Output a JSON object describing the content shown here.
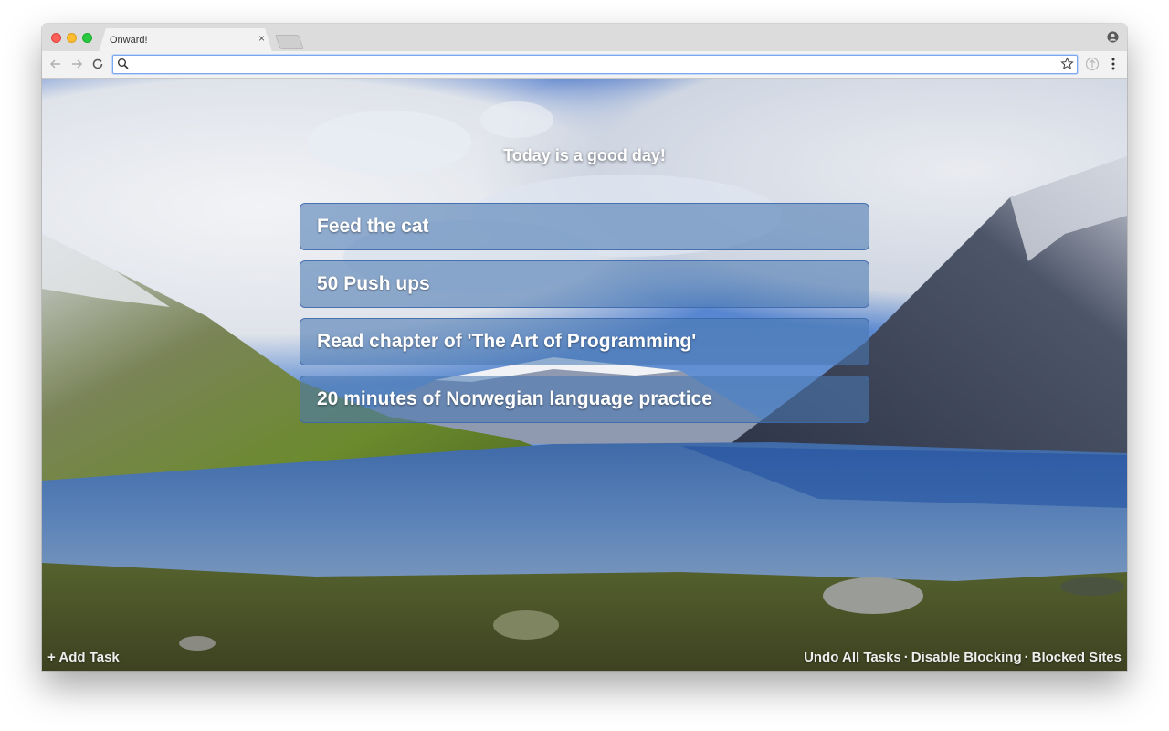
{
  "browser": {
    "tab_title": "Onward!",
    "tab_close": "×",
    "url": ""
  },
  "page": {
    "greeting": "Today is a good day!",
    "tasks": [
      "Feed the cat",
      "50 Push ups",
      "Read chapter of 'The Art of Programming'",
      "20 minutes of Norwegian language practice"
    ]
  },
  "footer": {
    "add_task": "+ Add Task",
    "undo_all": "Undo All Tasks",
    "disable_blocking": "Disable Blocking",
    "blocked_sites": "Blocked Sites",
    "separator": "·"
  },
  "icons": {
    "back": "back-arrow-icon",
    "forward": "forward-arrow-icon",
    "reload": "reload-icon",
    "search": "search-icon",
    "bookmark": "star-icon",
    "extension": "extension-icon",
    "menu": "kebab-menu-icon",
    "profile": "profile-icon"
  },
  "colors": {
    "task_bg": "#4a78b2",
    "omnibox_focus": "#7aa7ee"
  }
}
